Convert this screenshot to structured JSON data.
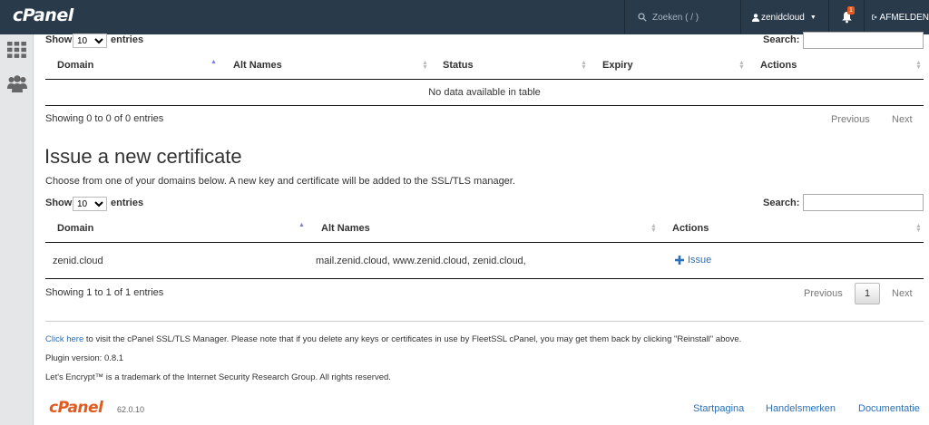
{
  "topbar": {
    "logo": "cPanel",
    "search_placeholder": "Zoeken ( / )",
    "username": "zenidcloud",
    "notification_count": "1",
    "logout_label": "AFMELDEN"
  },
  "sidebar": {
    "icons": [
      "grid-icon",
      "users-icon"
    ]
  },
  "certs_table": {
    "show_label": "Show",
    "entries_label": "entries",
    "length_value": "10",
    "search_label": "Search:",
    "columns": [
      "Domain",
      "Alt Names",
      "Status",
      "Expiry",
      "Actions"
    ],
    "empty_text": "No data available in table",
    "info": "Showing 0 to 0 of 0 entries",
    "previous": "Previous",
    "next": "Next"
  },
  "issue_section": {
    "title": "Issue a new certificate",
    "description": "Choose from one of your domains below. A new key and certificate will be added to the SSL/TLS manager.",
    "show_label": "Show",
    "entries_label": "entries",
    "length_value": "10",
    "search_label": "Search:",
    "columns": [
      "Domain",
      "Alt Names",
      "Actions"
    ],
    "rows": [
      {
        "domain": "zenid.cloud",
        "alt_names": "mail.zenid.cloud, www.zenid.cloud, zenid.cloud,",
        "action": "Issue"
      }
    ],
    "info": "Showing 1 to 1 of 1 entries",
    "previous": "Previous",
    "page": "1",
    "next": "Next"
  },
  "footer": {
    "click_here": "Click here",
    "notice": " to visit the cPanel SSL/TLS Manager. Please note that if you delete any keys or certificates in use by FleetSSL cPanel, you may get them back by clicking \"Reinstall\" above.",
    "plugin_version": "Plugin version: 0.8.1",
    "trademark": "Let's Encrypt™ is a trademark of the Internet Security Research Group. All rights reserved.",
    "cpanel_logo": "cPanel",
    "cpanel_version": "62.0.10",
    "links": [
      "Startpagina",
      "Handelsmerken",
      "Documentatie"
    ]
  },
  "colors": {
    "topbar_bg": "#293a4a",
    "link": "#2a6fb8",
    "brand_orange": "#e35a1f"
  }
}
